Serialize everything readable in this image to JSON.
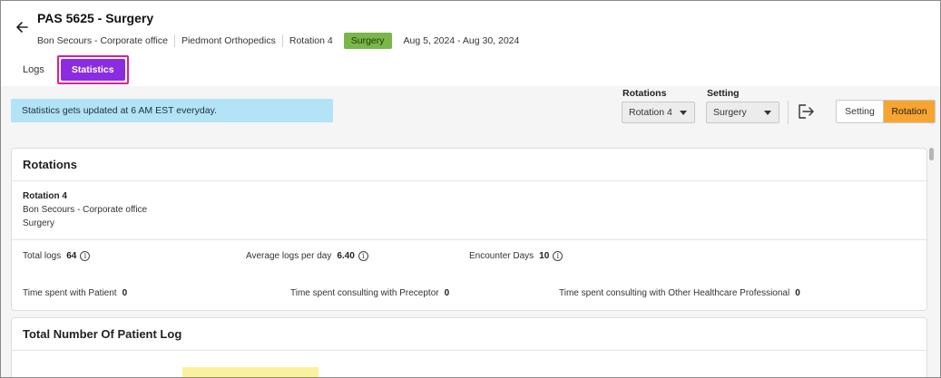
{
  "header": {
    "title": "PAS 5625 - Surgery",
    "meta": {
      "organization": "Bon Secours - Corporate office",
      "site": "Piedmont Orthopedics",
      "rotation": "Rotation 4",
      "setting_badge": "Surgery",
      "date_range": "Aug 5, 2024 - Aug 30, 2024"
    }
  },
  "tabs": {
    "logs": "Logs",
    "statistics": "Statistics"
  },
  "banner": {
    "text": "Statistics gets updated at 6 AM EST everyday."
  },
  "filters": {
    "rotations_label": "Rotations",
    "rotations_value": "Rotation 4",
    "setting_label": "Setting",
    "setting_value": "Surgery"
  },
  "view_toggle": {
    "setting": "Setting",
    "rotation": "Rotation",
    "active": "Rotation"
  },
  "colors": {
    "accent_purple": "#8b2be2",
    "highlight_pink": "#e01f8f",
    "badge_green": "#7ab648",
    "toggle_orange": "#f7a530",
    "banner_blue": "#b3e3f7"
  },
  "rotations_card": {
    "title": "Rotations",
    "rotation_name": "Rotation 4",
    "organization": "Bon Secours - Corporate office",
    "setting": "Surgery",
    "stats": {
      "total_logs_label": "Total logs",
      "total_logs_value": "64",
      "avg_logs_label": "Average logs per day",
      "avg_logs_value": "6.40",
      "encounter_days_label": "Encounter Days",
      "encounter_days_value": "10",
      "time_patient_label": "Time spent with Patient",
      "time_patient_value": "0",
      "time_preceptor_label": "Time spent consulting with Preceptor",
      "time_preceptor_value": "0",
      "time_other_label": "Time spent consulting with Other Healthcare Professional",
      "time_other_value": "0"
    }
  },
  "patient_log_card": {
    "title": "Total Number Of Patient Log"
  }
}
